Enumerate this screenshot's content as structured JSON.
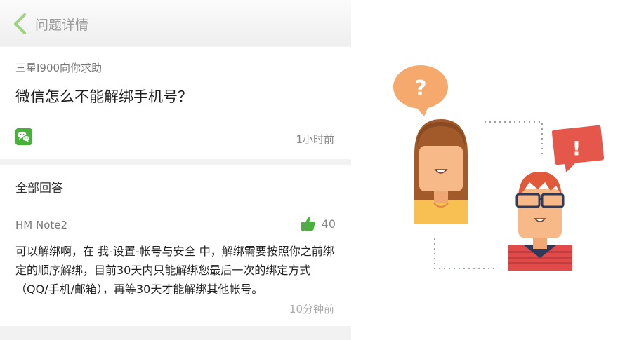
{
  "nav": {
    "title": "问题详情"
  },
  "question": {
    "asker": "三星I900向你求助",
    "title": "微信怎么不能解绑手机号？",
    "time": "1小时前"
  },
  "answers_section": {
    "title": "全部回答"
  },
  "answer": {
    "user": "HM Note2",
    "likes": "40",
    "body": "可以解绑啊，在 我-设置-帐号与安全 中，解绑需要按照你之前绑定的顺序解绑，目前30天内只能解绑您最后一次的绑定方式（QQ/手机/邮箱），再等30天才能解绑其他帐号。",
    "time": "10分钟前"
  },
  "illustration": {
    "left_bubble": "?",
    "right_bubble": "!"
  },
  "colors": {
    "accent_green": "#47b23a",
    "back_arrow": "#9ed37f",
    "bubble_orange": "#f6a96c",
    "bubble_red": "#e6574b"
  },
  "icons": [
    "back-arrow-icon",
    "wechat-icon",
    "thumbs-up-icon"
  ]
}
